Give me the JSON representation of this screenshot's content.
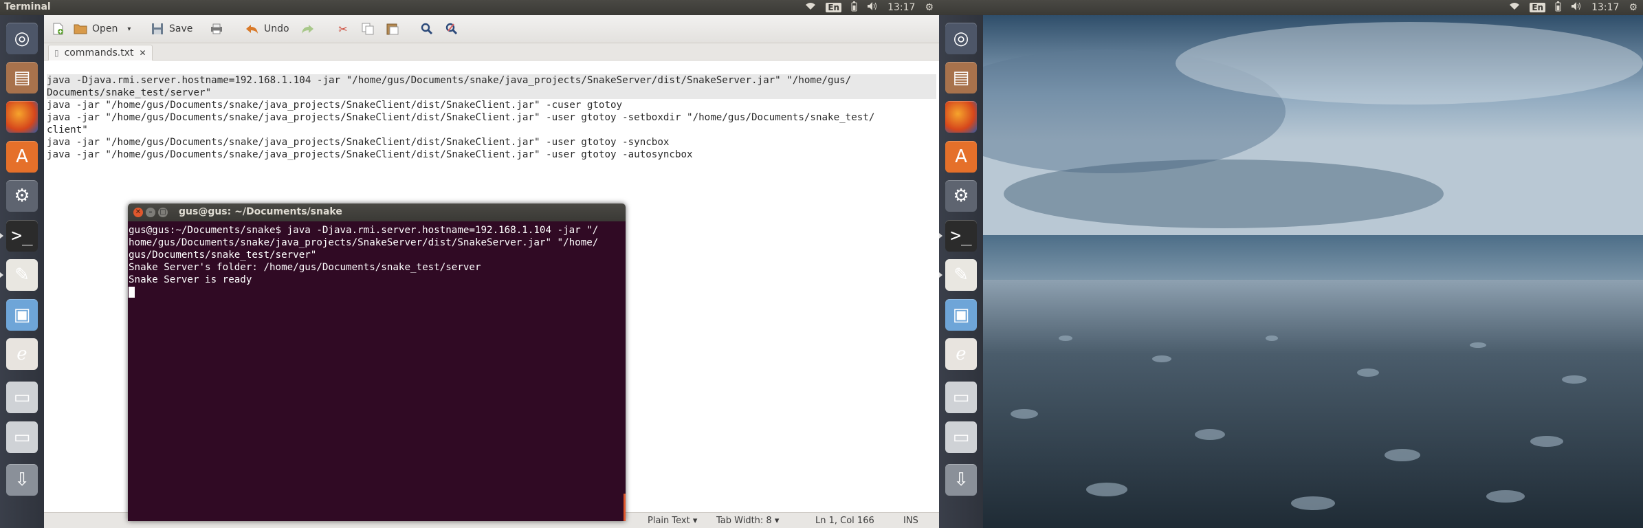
{
  "panel_left": {
    "title": "Terminal",
    "lang": "En",
    "time": "13:17"
  },
  "panel_right": {
    "lang": "En",
    "time": "13:17"
  },
  "launcher": {
    "items": [
      {
        "name": "ubuntu-dash",
        "icon": "ubuntu-logo-icon"
      },
      {
        "name": "files",
        "icon": "file-cabinet-icon"
      },
      {
        "name": "firefox",
        "icon": "firefox-icon"
      },
      {
        "name": "software-center",
        "icon": "software-center-icon"
      },
      {
        "name": "system-settings",
        "icon": "settings-icon"
      },
      {
        "name": "terminal",
        "icon": "terminal-icon"
      },
      {
        "name": "text-editor",
        "icon": "text-editor-icon"
      },
      {
        "name": "virtualbox",
        "icon": "virtualbox-icon"
      },
      {
        "name": "office-app",
        "icon": "red-app-icon"
      },
      {
        "name": "drive-1",
        "icon": "drive-icon"
      },
      {
        "name": "drive-2",
        "icon": "drive-icon"
      },
      {
        "name": "usb-drive",
        "icon": "usb-icon"
      }
    ]
  },
  "gedit": {
    "toolbar": {
      "open_label": "Open",
      "save_label": "Save",
      "undo_label": "Undo"
    },
    "tab_label": "commands.txt",
    "lines": [
      "java -Djava.rmi.server.hostname=192.168.1.104 -jar \"/home/gus/Documents/snake/java_projects/SnakeServer/dist/SnakeServer.jar\" \"/home/gus/",
      "Documents/snake_test/server\"",
      "java -jar \"/home/gus/Documents/snake/java_projects/SnakeClient/dist/SnakeClient.jar\" -cuser gtotoy",
      "java -jar \"/home/gus/Documents/snake/java_projects/SnakeClient/dist/SnakeClient.jar\" -user gtotoy -setboxdir \"/home/gus/Documents/snake_test/",
      "client\"",
      "java -jar \"/home/gus/Documents/snake/java_projects/SnakeClient/dist/SnakeClient.jar\" -user gtotoy -syncbox",
      "java -jar \"/home/gus/Documents/snake/java_projects/SnakeClient/dist/SnakeClient.jar\" -user gtotoy -autosyncbox"
    ],
    "status": {
      "syntax": "Plain Text",
      "tab_width": "Tab Width: 8",
      "position": "Ln 1, Col 166",
      "mode": "INS"
    }
  },
  "terminal": {
    "title": "gus@gus: ~/Documents/snake",
    "lines": [
      "gus@gus:~/Documents/snake$ java -Djava.rmi.server.hostname=192.168.1.104 -jar \"/",
      "home/gus/Documents/snake/java_projects/SnakeServer/dist/SnakeServer.jar\" \"/home/",
      "gus/Documents/snake_test/server\"",
      "Snake Server's folder: /home/gus/Documents/snake_test/server",
      "Snake Server is ready"
    ]
  }
}
